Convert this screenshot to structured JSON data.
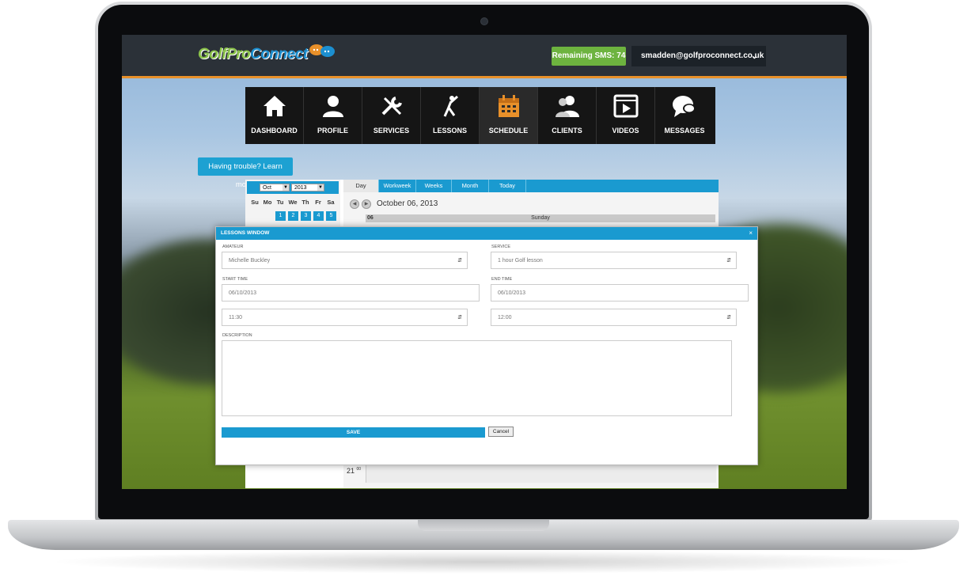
{
  "header": {
    "logo_text_a": "GolfPro",
    "logo_text_b": "Connect",
    "sms_label": "Remaining SMS: 74",
    "user_email": "smadden@golfproconnect.co.uk"
  },
  "nav": {
    "items": [
      {
        "label": "DASHBOARD",
        "icon": "house-icon"
      },
      {
        "label": "PROFILE",
        "icon": "person-icon"
      },
      {
        "label": "SERVICES",
        "icon": "tools-icon"
      },
      {
        "label": "LESSONS",
        "icon": "golfer-icon"
      },
      {
        "label": "SCHEDULE",
        "icon": "calendar-icon",
        "active": true
      },
      {
        "label": "CLIENTS",
        "icon": "people-icon"
      },
      {
        "label": "VIDEOS",
        "icon": "film-icon"
      },
      {
        "label": "MESSAGES",
        "icon": "chat-icon"
      }
    ]
  },
  "help_link": "Having trouble? Learn more.",
  "mini_calendar": {
    "month": "Oct",
    "year": "2013",
    "weekdays": [
      "Su",
      "Mo",
      "Tu",
      "We",
      "Th",
      "Fr",
      "Sa"
    ],
    "first_row_days": [
      "1",
      "2",
      "3",
      "4",
      "5"
    ]
  },
  "scheduler": {
    "tabs": [
      "Day",
      "Workweek",
      "Weeks",
      "Month",
      "Today"
    ],
    "active_tab": "Day",
    "date_header": "October 06, 2013",
    "day_number": "06",
    "day_name": "Sunday",
    "hour_label": "21",
    "hour_minutes": "00"
  },
  "modal": {
    "title": "LESSONS WINDOW",
    "amateur_label": "AMATEUR",
    "amateur_value": "Michelle Buckley",
    "service_label": "SERVICE",
    "service_value": "1 hour Golf lesson",
    "start_time_label": "START TIME",
    "start_date": "06/10/2013",
    "start_time": "11:30",
    "end_time_label": "END TIME",
    "end_date": "06/10/2013",
    "end_time": "12:00",
    "description_label": "DESCRIPTION",
    "save_label": "SAVE",
    "cancel_label": "Cancel"
  },
  "colors": {
    "accent_blue": "#1a9ad0",
    "sms_green": "#6db33f",
    "header_orange": "#e8902a",
    "active_calendar_icon": "#e8902a"
  }
}
